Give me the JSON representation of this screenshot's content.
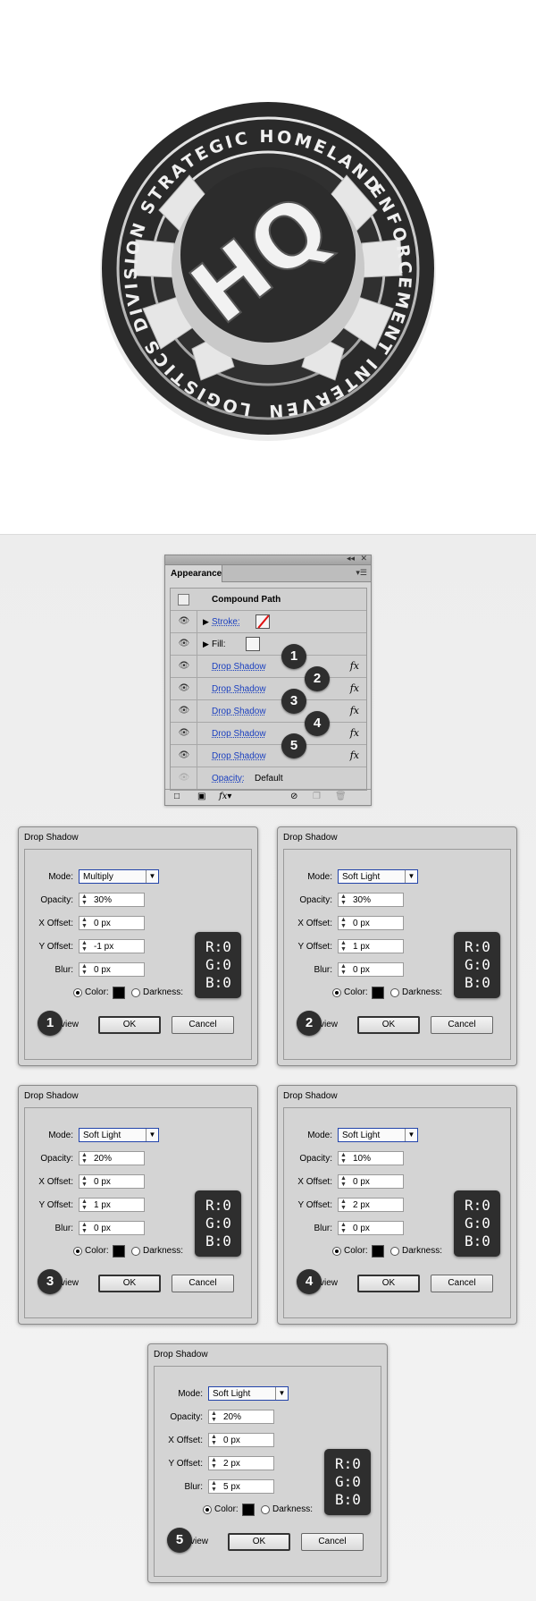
{
  "badge": {
    "ring_top": "LOGISTICS DIVISION STRATEGIC HOMELAND",
    "ring_bottom": "ENFORCEMENT INTERVENTION",
    "center_letters": "HQ"
  },
  "appearance": {
    "panel_tab": "Appearance",
    "target": "Compound Path",
    "stroke_label": "Stroke:",
    "fill_label": "Fill:",
    "effects": [
      "Drop Shadow",
      "Drop Shadow",
      "Drop Shadow",
      "Drop Shadow",
      "Drop Shadow"
    ],
    "fx": "fx",
    "opacity_label": "Opacity:",
    "opacity_value": "Default",
    "markers": [
      "1",
      "2",
      "3",
      "4",
      "5"
    ]
  },
  "dialogs": [
    {
      "title": "Drop Shadow",
      "mode": "Multiply",
      "opacity": "30%",
      "x_offset": "0 px",
      "y_offset": "-1 px",
      "blur": "0 px",
      "marker": "1"
    },
    {
      "title": "Drop Shadow",
      "mode": "Soft Light",
      "opacity": "30%",
      "x_offset": "0 px",
      "y_offset": "1 px",
      "blur": "0 px",
      "marker": "2"
    },
    {
      "title": "Drop Shadow",
      "mode": "Soft Light",
      "opacity": "20%",
      "x_offset": "0 px",
      "y_offset": "1 px",
      "blur": "0 px",
      "marker": "3"
    },
    {
      "title": "Drop Shadow",
      "mode": "Soft Light",
      "opacity": "10%",
      "x_offset": "0 px",
      "y_offset": "2 px",
      "blur": "0 px",
      "marker": "4"
    },
    {
      "title": "Drop Shadow",
      "mode": "Soft Light",
      "opacity": "20%",
      "x_offset": "0 px",
      "y_offset": "2 px",
      "blur": "5 px",
      "marker": "5"
    }
  ],
  "dialog_labels": {
    "mode": "Mode:",
    "opacity": "Opacity:",
    "x_offset": "X Offset:",
    "y_offset": "Y Offset:",
    "blur": "Blur:",
    "color": "Color:",
    "darkness": "Darkness:",
    "preview": "view",
    "ok": "OK",
    "cancel": "Cancel"
  },
  "rgb": {
    "r": "R:0",
    "g": "G:0",
    "b": "B:0"
  },
  "colors": {
    "shadow_color": "#000000",
    "badge_dark": "#333333",
    "marker_bg": "#2e2e2e"
  }
}
